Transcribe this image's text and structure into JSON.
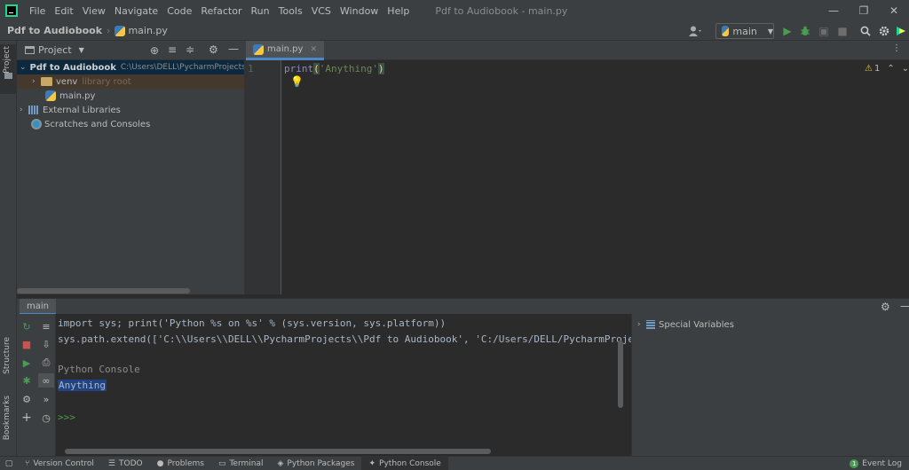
{
  "menubar": {
    "items": [
      "File",
      "Edit",
      "View",
      "Navigate",
      "Code",
      "Refactor",
      "Run",
      "Tools",
      "VCS",
      "Window",
      "Help"
    ],
    "window_title": "Pdf to Audiobook - main.py"
  },
  "navbar": {
    "project": "Pdf to Audiobook",
    "file": "main.py",
    "run_config": "main"
  },
  "left_stripe": {
    "project_tab": "Project",
    "structure_tab": "Structure",
    "bookmarks_tab": "Bookmarks"
  },
  "project_panel": {
    "title": "Project",
    "root_name": "Pdf to Audiobook",
    "root_path": "C:\\Users\\DELL\\PycharmProjects\\",
    "venv": "venv",
    "venv_hint": "library root",
    "main_file": "main.py",
    "external_libraries": "External Libraries",
    "scratches": "Scratches and Consoles"
  },
  "editor": {
    "tab_label": "main.py",
    "line_number": "1",
    "code_fn": "print",
    "code_open": "(",
    "code_string": "'Anything'",
    "code_close": ")",
    "warning_count": "1"
  },
  "console": {
    "tab_label": "main",
    "lines": [
      "import sys; print('Python %s on %s' % (sys.version, sys.platform))",
      "sys.path.extend(['C:\\\\Users\\\\DELL\\\\PycharmProjects\\\\Pdf to Audiobook', 'C:/Users/DELL/PycharmProjec",
      "Python Console",
      "Anything",
      ">>>"
    ],
    "special_variables": "Special Variables"
  },
  "statusbar": {
    "items": [
      "Version Control",
      "TODO",
      "Problems",
      "Terminal",
      "Python Packages",
      "Python Console"
    ],
    "event_log": "Event Log",
    "event_count": "1"
  },
  "colors": {
    "accent": "#4a88c7",
    "run_green": "#499c54",
    "bg_dark": "#2b2b2b",
    "panel": "#3c3f41"
  }
}
